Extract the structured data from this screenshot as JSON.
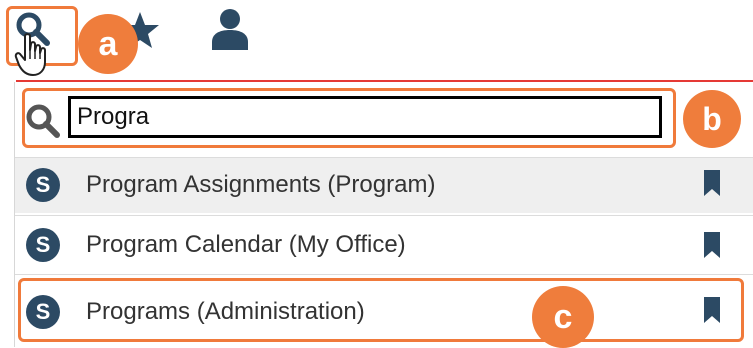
{
  "toolbar": {
    "icons": [
      "search-icon",
      "star-icon",
      "user-icon"
    ]
  },
  "callouts": {
    "a": "a",
    "b": "b",
    "c": "c"
  },
  "search": {
    "value": "Progra"
  },
  "results": [
    {
      "badge": "S",
      "label": "Program Assignments (Program)",
      "highlighted": true
    },
    {
      "badge": "S",
      "label": "Program Calendar (My Office)",
      "highlighted": false
    },
    {
      "badge": "S",
      "label": "Programs (Administration)",
      "highlighted": false
    }
  ],
  "colors": {
    "accent": "#f07a3b",
    "badge": "#2c4a64",
    "divider": "#e53935"
  }
}
